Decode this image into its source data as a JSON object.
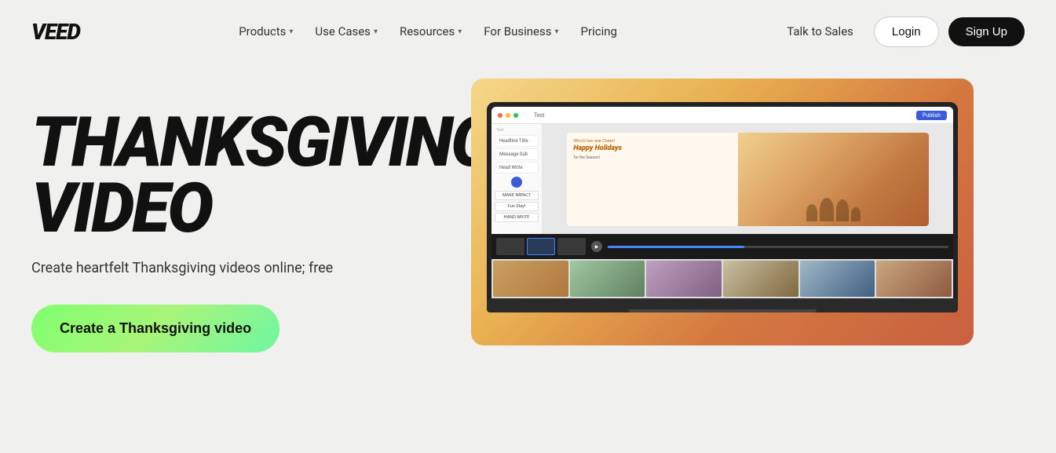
{
  "brand": {
    "logo": "VEED"
  },
  "nav": {
    "items": [
      {
        "label": "Products",
        "hasDropdown": true
      },
      {
        "label": "Use Cases",
        "hasDropdown": true
      },
      {
        "label": "Resources",
        "hasDropdown": true
      },
      {
        "label": "For Business",
        "hasDropdown": true
      },
      {
        "label": "Pricing",
        "hasDropdown": false
      }
    ],
    "right": {
      "talk_to_sales": "Talk to Sales",
      "login": "Login",
      "signup": "Sign Up"
    }
  },
  "hero": {
    "title_line1": "THANKSGIVING",
    "title_line2": "VIDEO",
    "subtitle": "Create heartfelt Thanksgiving videos online; free",
    "cta_label": "Create a Thanksgiving video"
  },
  "editor": {
    "tab_label": "Test",
    "publish_label": "Publish",
    "canvas_text_small": "Which hav ane Cheer!",
    "canvas_title": "Happy Holidays",
    "panel_sections": [
      {
        "label": "Text"
      },
      {
        "label": "Headline Title"
      },
      {
        "label": "Message Sub"
      },
      {
        "label": "Head Write"
      }
    ],
    "text_chips": [
      "MAKE IMPACT",
      "Fun Stay!",
      "HAND WRITE"
    ]
  },
  "colors": {
    "background": "#f0f0ee",
    "nav_bg": "#f0f0ee",
    "cta_gradient_start": "#7fff6e",
    "cta_gradient_end": "#6ef5a2",
    "hero_gradient_start": "#f5d88a",
    "hero_gradient_end": "#c86040",
    "signup_bg": "#111111",
    "accent_blue": "#3b5bdb"
  }
}
